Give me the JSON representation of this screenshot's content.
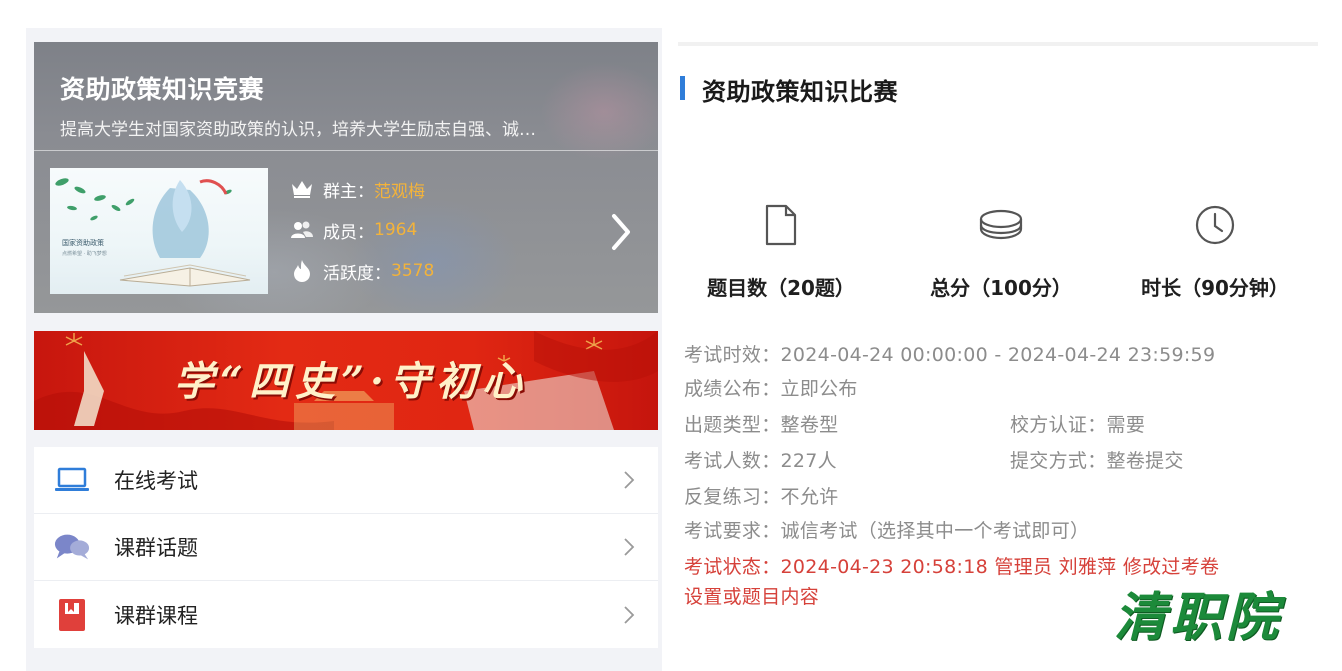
{
  "group": {
    "title": "资助政策知识竞赛",
    "description": "提高大学生对国家资助政策的认识，培养大学生励志自强、诚…",
    "cover_text": "国家资助政策",
    "cover_subtext": "点燃希望 · 助飞梦想",
    "owner_label": "群主：",
    "owner_value": "范观梅",
    "members_label": "成员：",
    "members_value": "1964",
    "activity_label": "活跃度：",
    "activity_value": "3578"
  },
  "banner": {
    "text": "学“四史”·守初心"
  },
  "menu": [
    {
      "label": "在线考试",
      "icon": "laptop-icon"
    },
    {
      "label": "课群话题",
      "icon": "chat-bubbles-icon"
    },
    {
      "label": "课群课程",
      "icon": "book-icon"
    }
  ],
  "exam": {
    "title": "资助政策知识比赛",
    "stats": [
      {
        "label": "题目数（20题）",
        "icon": "document-icon"
      },
      {
        "label": "总分（100分）",
        "icon": "coins-icon"
      },
      {
        "label": "时长（90分钟）",
        "icon": "clock-icon"
      }
    ],
    "details": {
      "validity_key": "考试时效：",
      "validity_value": "2024-04-24 00:00:00 - 2024-04-24 23:59:59",
      "publish_key": "成绩公布：",
      "publish_value": "立即公布",
      "type_key": "出题类型：",
      "type_value": "整卷型",
      "auth_key": "校方认证：",
      "auth_value": "需要",
      "count_key": "考试人数：",
      "count_value": "227人",
      "submit_key": "提交方式：",
      "submit_value": "整卷提交",
      "practice_key": "反复练习：",
      "practice_value": "不允许",
      "require_key": "考试要求：",
      "require_value": "诚信考试（选择其中一个考试即可）",
      "status_key": "考试状态：",
      "status_value": "2024-04-23 20:58:18 管理员 刘雅萍 修改过考卷",
      "status_value_2": "设置或题目内容"
    },
    "watermark": "清职院"
  },
  "colors": {
    "accent_blue": "#2f7dd9",
    "highlight_yellow": "#f3b33a",
    "status_red": "#d6413a",
    "watermark_green": "#1c8a3a"
  }
}
